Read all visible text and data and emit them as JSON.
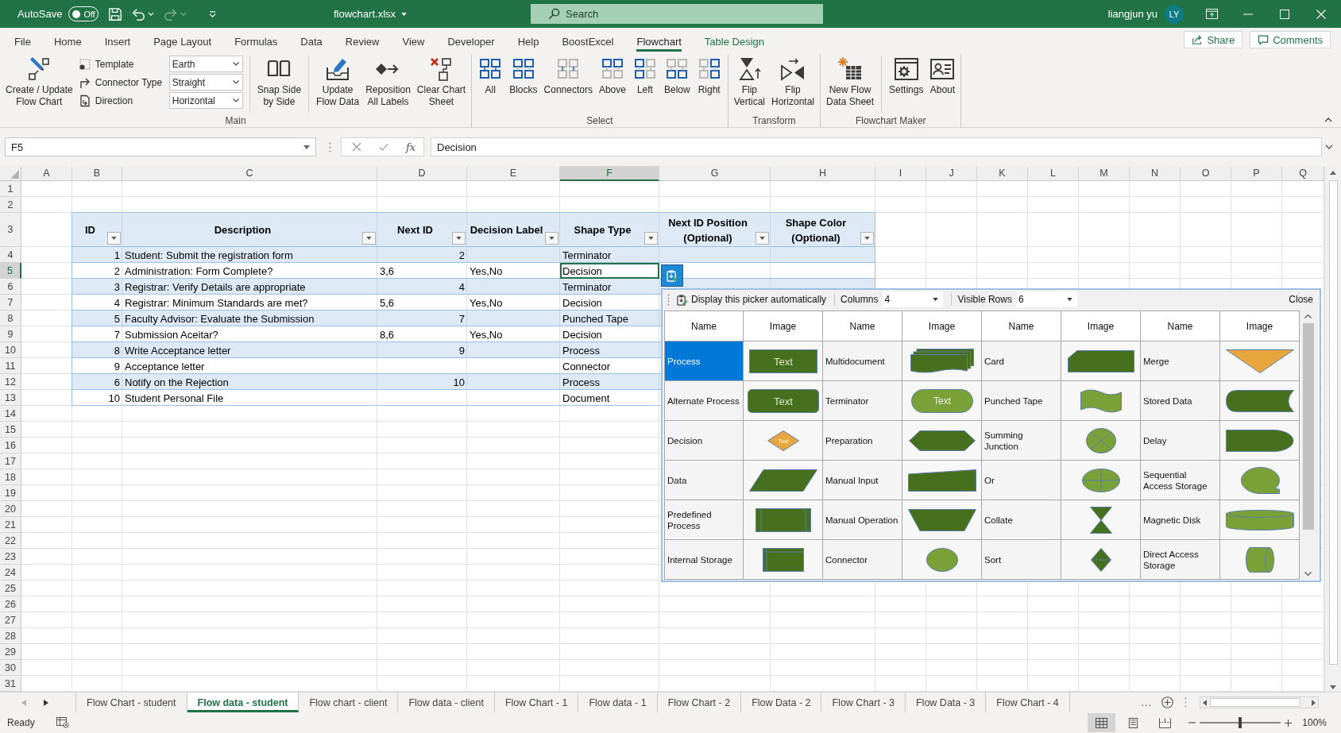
{
  "title_bar": {
    "autosave": {
      "label": "AutoSave",
      "on": false,
      "state_text": "Off"
    },
    "undo": {
      "disabled": false
    },
    "redo": {
      "disabled": true
    },
    "file_name": "flowchart.xlsx",
    "search": {
      "placeholder": "Search"
    },
    "user_name": "liangjun yu",
    "user_initials": "LY"
  },
  "ribbon_tabs": [
    {
      "label": "File",
      "selected": false,
      "kind": "standard"
    },
    {
      "label": "Home",
      "selected": false,
      "kind": "standard"
    },
    {
      "label": "Insert",
      "selected": false,
      "kind": "standard"
    },
    {
      "label": "Page Layout",
      "selected": false,
      "kind": "standard"
    },
    {
      "label": "Formulas",
      "selected": false,
      "kind": "standard"
    },
    {
      "label": "Data",
      "selected": false,
      "kind": "standard"
    },
    {
      "label": "Review",
      "selected": false,
      "kind": "standard"
    },
    {
      "label": "View",
      "selected": false,
      "kind": "standard"
    },
    {
      "label": "Developer",
      "selected": false,
      "kind": "standard"
    },
    {
      "label": "Help",
      "selected": false,
      "kind": "standard"
    },
    {
      "label": "BoostExcel",
      "selected": false,
      "kind": "standard"
    },
    {
      "label": "Flowchart",
      "selected": true,
      "kind": "standard"
    },
    {
      "label": "Table Design",
      "selected": false,
      "kind": "contextual"
    }
  ],
  "share_button": "Share",
  "comments_button": "Comments",
  "ribbon_groups": [
    {
      "label": "Main",
      "items": [
        {
          "kind": "large",
          "lines": [
            "Create / Update",
            "Flow Chart"
          ]
        },
        {
          "kind": "options",
          "rows": [
            {
              "label": "Template",
              "value": "Earth"
            },
            {
              "label": "Connector Type",
              "value": "Straight"
            },
            {
              "label": "Direction",
              "value": "Horizontal"
            }
          ]
        },
        {
          "kind": "separator"
        },
        {
          "kind": "large",
          "lines": [
            "Snap Side",
            "by Side"
          ]
        },
        {
          "kind": "separator"
        },
        {
          "kind": "large",
          "lines": [
            "Update",
            "Flow Data"
          ]
        },
        {
          "kind": "large",
          "lines": [
            "Reposition",
            "All Labels"
          ]
        },
        {
          "kind": "large",
          "lines": [
            "Clear Chart",
            "Sheet"
          ]
        }
      ]
    },
    {
      "label": "Select",
      "items": [
        {
          "kind": "large",
          "lines": [
            "All"
          ]
        },
        {
          "kind": "large",
          "lines": [
            "Blocks"
          ]
        },
        {
          "kind": "large",
          "lines": [
            "Connectors"
          ]
        },
        {
          "kind": "large",
          "lines": [
            "Above"
          ]
        },
        {
          "kind": "large",
          "lines": [
            "Left"
          ]
        },
        {
          "kind": "large",
          "lines": [
            "Below"
          ]
        },
        {
          "kind": "large",
          "lines": [
            "Right"
          ]
        }
      ]
    },
    {
      "label": "Transform",
      "items": [
        {
          "kind": "large",
          "lines": [
            "Flip",
            "Vertical"
          ]
        },
        {
          "kind": "large",
          "lines": [
            "Flip",
            "Horizontal"
          ]
        }
      ]
    },
    {
      "label": "Flowchart Maker",
      "items": [
        {
          "kind": "large",
          "lines": [
            "New Flow",
            "Data Sheet"
          ]
        },
        {
          "kind": "separator"
        },
        {
          "kind": "large",
          "lines": [
            "Settings"
          ]
        },
        {
          "kind": "large",
          "lines": [
            "About"
          ]
        }
      ]
    }
  ],
  "formula_bar": {
    "name_box": "F5",
    "function_label": "fx",
    "formula": "Decision"
  },
  "sheet": {
    "columns": [
      {
        "label": "A",
        "selected": false
      },
      {
        "label": "B",
        "selected": false
      },
      {
        "label": "C",
        "selected": false
      },
      {
        "label": "D",
        "selected": false
      },
      {
        "label": "E",
        "selected": false
      },
      {
        "label": "F",
        "selected": true
      },
      {
        "label": "G",
        "selected": false
      },
      {
        "label": "H",
        "selected": false
      },
      {
        "label": "I",
        "selected": false
      },
      {
        "label": "J",
        "selected": false
      },
      {
        "label": "K",
        "selected": false
      },
      {
        "label": "L",
        "selected": false
      },
      {
        "label": "M",
        "selected": false
      },
      {
        "label": "N",
        "selected": false
      },
      {
        "label": "O",
        "selected": false
      },
      {
        "label": "P",
        "selected": false
      },
      {
        "label": "Q",
        "selected": false
      }
    ],
    "row_numbers": [
      {
        "label": "1",
        "selected": false
      },
      {
        "label": "2",
        "selected": false
      },
      {
        "label": "3",
        "selected": false
      },
      {
        "label": "4",
        "selected": false
      },
      {
        "label": "5",
        "selected": true
      },
      {
        "label": "6",
        "selected": false
      },
      {
        "label": "7",
        "selected": false
      },
      {
        "label": "8",
        "selected": false
      },
      {
        "label": "9",
        "selected": false
      },
      {
        "label": "10",
        "selected": false
      },
      {
        "label": "11",
        "selected": false
      },
      {
        "label": "12",
        "selected": false
      },
      {
        "label": "13",
        "selected": false
      },
      {
        "label": "14",
        "selected": false
      },
      {
        "label": "15",
        "selected": false
      },
      {
        "label": "16",
        "selected": false
      },
      {
        "label": "17",
        "selected": false
      },
      {
        "label": "18",
        "selected": false
      },
      {
        "label": "19",
        "selected": false
      },
      {
        "label": "20",
        "selected": false
      },
      {
        "label": "21",
        "selected": false
      },
      {
        "label": "22",
        "selected": false
      },
      {
        "label": "23",
        "selected": false
      },
      {
        "label": "24",
        "selected": false
      },
      {
        "label": "25",
        "selected": false
      },
      {
        "label": "26",
        "selected": false
      },
      {
        "label": "27",
        "selected": false
      },
      {
        "label": "28",
        "selected": false
      },
      {
        "label": "29",
        "selected": false
      },
      {
        "label": "30",
        "selected": false
      },
      {
        "label": "31",
        "selected": false
      }
    ],
    "table": {
      "headers": [
        "ID",
        "Description",
        "Next ID",
        "Decision Label",
        "Shape Type",
        "Next ID Position (Optional)",
        "Shape Color (Optional)"
      ],
      "rows": [
        {
          "id": "1",
          "description": "Student: Submit the registration form",
          "next_id": {
            "value": "2",
            "kind": "number"
          },
          "shape_type": "Terminator"
        },
        {
          "id": "2",
          "description": "Administration: Form Complete?",
          "next_id": {
            "value": "3,6",
            "kind": "text"
          },
          "decision_label": "Yes,No",
          "shape_type": "Decision"
        },
        {
          "id": "3",
          "description": "Registrar: Verify Details are appropriate",
          "next_id": {
            "value": "4",
            "kind": "number"
          },
          "shape_type": "Terminator"
        },
        {
          "id": "4",
          "description": "Registrar: Minimum Standards are met?",
          "next_id": {
            "value": "5,6",
            "kind": "text"
          },
          "decision_label": "Yes,No",
          "shape_type": "Decision"
        },
        {
          "id": "5",
          "description": "Faculty Advisor: Evaluate the Submission",
          "next_id": {
            "value": "7",
            "kind": "number"
          },
          "shape_type": "Punched Tape"
        },
        {
          "id": "7",
          "description": "Submission Aceitar?",
          "next_id": {
            "value": "8,6",
            "kind": "text"
          },
          "decision_label": "Yes,No",
          "shape_type": "Decision"
        },
        {
          "id": "8",
          "description": "Write Acceptance letter",
          "next_id": {
            "value": "9",
            "kind": "number"
          },
          "shape_type": "Process"
        },
        {
          "id": "9",
          "description": "Acceptance letter",
          "shape_type": "Connector"
        },
        {
          "id": "6",
          "description": "Notify on the Rejection",
          "next_id": {
            "value": "10",
            "kind": "number"
          },
          "shape_type": "Process"
        },
        {
          "id": "10",
          "description": "Student Personal File",
          "shape_type": "Document"
        }
      ]
    }
  },
  "shape_picker": {
    "auto_display_label": "Display this picker automatically",
    "columns_label": "Columns",
    "columns_value": "4",
    "visible_rows_label": "Visible Rows",
    "visible_rows_value": "6",
    "close_label": "Close",
    "header": [
      "Name",
      "Image",
      "Name",
      "Image",
      "Name",
      "Image",
      "Name",
      "Image"
    ],
    "shapes": [
      {
        "name": "Process",
        "selected": true,
        "image_text": "Text"
      },
      {
        "name": "Multidocument",
        "selected": false
      },
      {
        "name": "Card",
        "selected": false
      },
      {
        "name": "Merge",
        "selected": false
      },
      {
        "name": "Alternate Process",
        "selected": false,
        "image_text": "Text"
      },
      {
        "name": "Terminator",
        "selected": false,
        "image_text": "Text"
      },
      {
        "name": "Punched Tape",
        "selected": false
      },
      {
        "name": "Stored Data",
        "selected": false
      },
      {
        "name": "Decision",
        "selected": false,
        "image_text": "Text"
      },
      {
        "name": "Preparation",
        "selected": false
      },
      {
        "name": "Summing Junction",
        "selected": false
      },
      {
        "name": "Delay",
        "selected": false
      },
      {
        "name": "Data",
        "selected": false
      },
      {
        "name": "Manual Input",
        "selected": false
      },
      {
        "name": "Or",
        "selected": false
      },
      {
        "name": "Sequential Access Storage",
        "selected": false
      },
      {
        "name": "Predefined Process",
        "selected": false
      },
      {
        "name": "Manual Operation",
        "selected": false
      },
      {
        "name": "Collate",
        "selected": false
      },
      {
        "name": "Magnetic Disk",
        "selected": false
      },
      {
        "name": "Internal Storage",
        "selected": false
      },
      {
        "name": "Connector",
        "selected": false
      },
      {
        "name": "Sort",
        "selected": false
      },
      {
        "name": "Direct Access Storage",
        "selected": false
      }
    ]
  },
  "sheet_tabs": [
    {
      "label": "Flow Chart - student",
      "selected": false
    },
    {
      "label": "Flow data - student",
      "selected": true
    },
    {
      "label": "Flow chart - client",
      "selected": false
    },
    {
      "label": "Flow data - client",
      "selected": false
    },
    {
      "label": "Flow Chart - 1",
      "selected": false
    },
    {
      "label": "Flow data - 1",
      "selected": false
    },
    {
      "label": "Flow Chart - 2",
      "selected": false
    },
    {
      "label": "Flow Data - 2",
      "selected": false
    },
    {
      "label": "Flow Chart - 3",
      "selected": false
    },
    {
      "label": "Flow Data - 3",
      "selected": false
    },
    {
      "label": "Flow Chart - 4",
      "selected": false
    }
  ],
  "more_tabs_label": "...",
  "status_bar": {
    "status": "Ready",
    "views": [
      {
        "selected": true
      },
      {
        "selected": false
      },
      {
        "selected": false
      }
    ],
    "zoom": {
      "level": 0.5,
      "reading": "100%"
    }
  }
}
